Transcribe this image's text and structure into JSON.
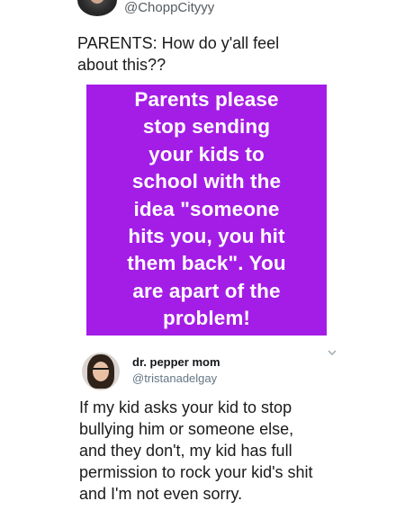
{
  "top_tweet": {
    "handle": "@ChoppCityyy",
    "text_lines": [
      "PARENTS: How do y'all feel",
      "about this??"
    ],
    "avatar_icon": "user-avatar",
    "image_card": {
      "background": "#a41de6",
      "lines": [
        "Parents please",
        "stop sending",
        "your kids to",
        "school with the",
        "idea \"someone",
        "hits you, you hit",
        "them back\". You",
        "are apart of the",
        "problem!"
      ]
    }
  },
  "reply_tweet": {
    "display_name": "dr. pepper mom",
    "handle": "@tristanadelgay",
    "avatar_icon": "user-avatar",
    "menu_icon": "chevron-down-icon",
    "text_lines": [
      "If my kid asks your kid to stop",
      "bullying him or someone else,",
      "and they don't, my kid has full",
      "permission to rock your kid's shit",
      "and I'm not even sorry."
    ]
  }
}
